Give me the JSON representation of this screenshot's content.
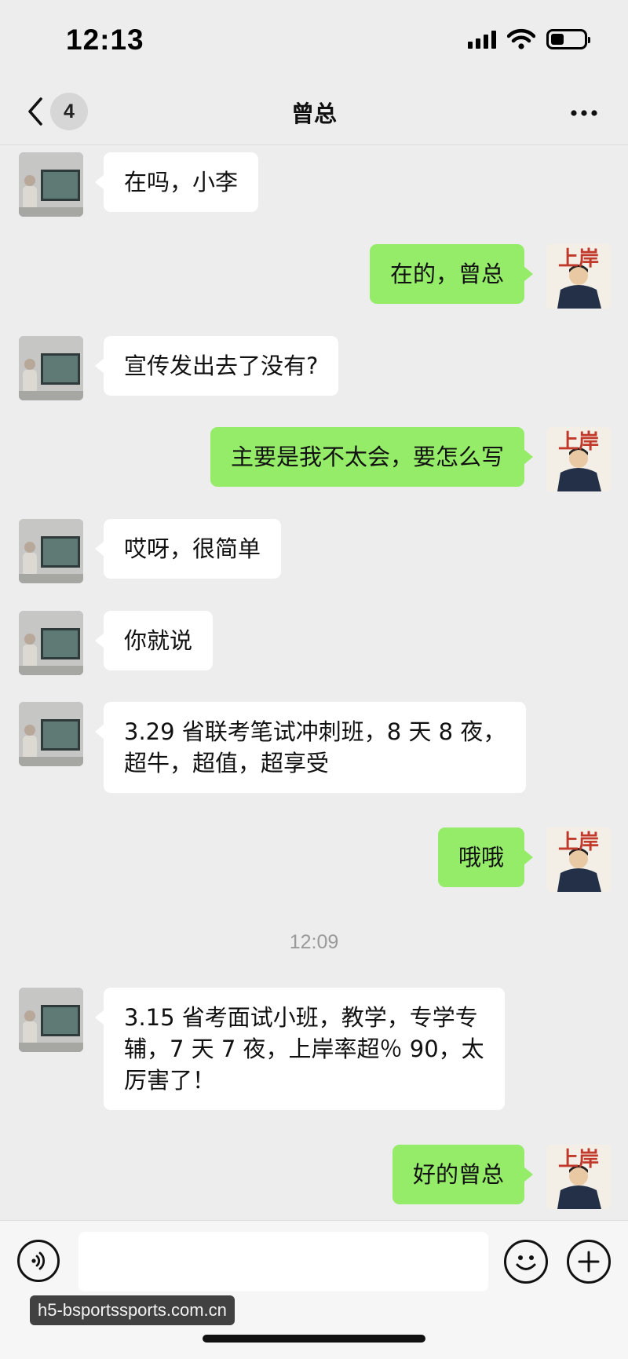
{
  "status_bar": {
    "time": "12:13",
    "battery_level": 0.4
  },
  "nav": {
    "unread_count": "4",
    "title": "曾总",
    "back_icon": "chevron-left-icon",
    "more_icon": "more-dots-icon"
  },
  "messages": [
    {
      "side": "left",
      "text": "在吗，小李"
    },
    {
      "side": "right",
      "text": "在的，曾总"
    },
    {
      "side": "left",
      "text": "宣传发出去了没有?"
    },
    {
      "side": "right",
      "text": "主要是我不太会，要怎么写"
    },
    {
      "side": "left",
      "text": "哎呀，很简单"
    },
    {
      "side": "left",
      "text": "你就说"
    },
    {
      "side": "left",
      "text": "3.29 省联考笔试冲刺班，8 天 8 夜，\n超牛，超值，超享受"
    },
    {
      "side": "right",
      "text": "哦哦"
    },
    {
      "type": "timestamp",
      "text": "12:09"
    },
    {
      "side": "left",
      "text": "3.15 省考面试小班，教学，专学专\n辅，7 天 7 夜，上岸率超％ 90，太\n厉害了！"
    },
    {
      "side": "right",
      "text": "好的曾总"
    }
  ],
  "sticker_avatar": {
    "text": "上岸"
  },
  "input_bar": {
    "voice_icon": "voice-icon",
    "emoji_icon": "emoji-icon",
    "plus_icon": "plus-icon",
    "input_value": ""
  },
  "watermark": "h5-bsportssports.com.cn",
  "colors": {
    "background": "#ededed",
    "bubble_self": "#95ec69",
    "bubble_other": "#ffffff",
    "timestamp": "#9a9a9a"
  }
}
